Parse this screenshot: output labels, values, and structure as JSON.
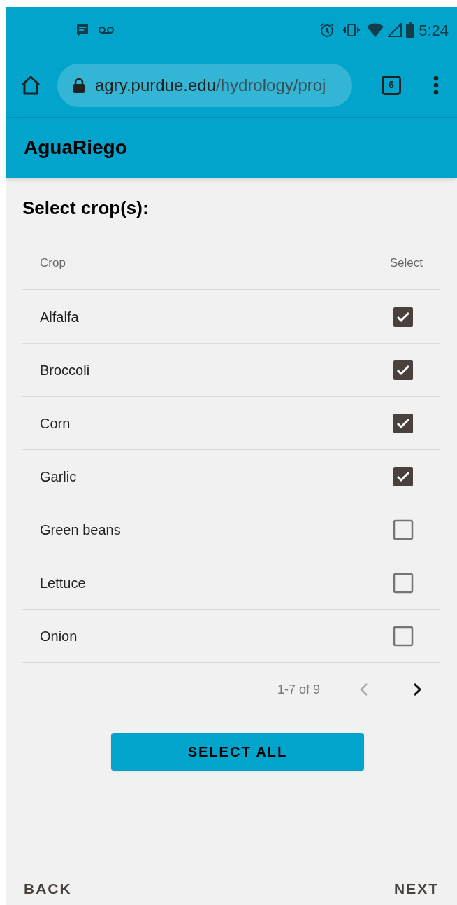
{
  "status_bar": {
    "time": "5:24"
  },
  "browser": {
    "url_host": "agry.purdue.edu",
    "url_path": "/hydrology/proj",
    "tab_count": "6"
  },
  "app_bar": {
    "title": "AguaRiego"
  },
  "heading": "Select crop(s):",
  "table": {
    "columns": [
      "Crop",
      "Select"
    ],
    "rows": [
      {
        "crop": "Alfalfa",
        "checked": true
      },
      {
        "crop": "Broccoli",
        "checked": true
      },
      {
        "crop": "Corn",
        "checked": true
      },
      {
        "crop": "Garlic",
        "checked": true
      },
      {
        "crop": "Green beans",
        "checked": false
      },
      {
        "crop": "Lettuce",
        "checked": false
      },
      {
        "crop": "Onion",
        "checked": false
      }
    ]
  },
  "pagination": {
    "range": "1-7 of 9",
    "prev_disabled": true,
    "next_disabled": false
  },
  "select_all": "SELECT ALL",
  "back": "BACK",
  "next": "NEXT"
}
